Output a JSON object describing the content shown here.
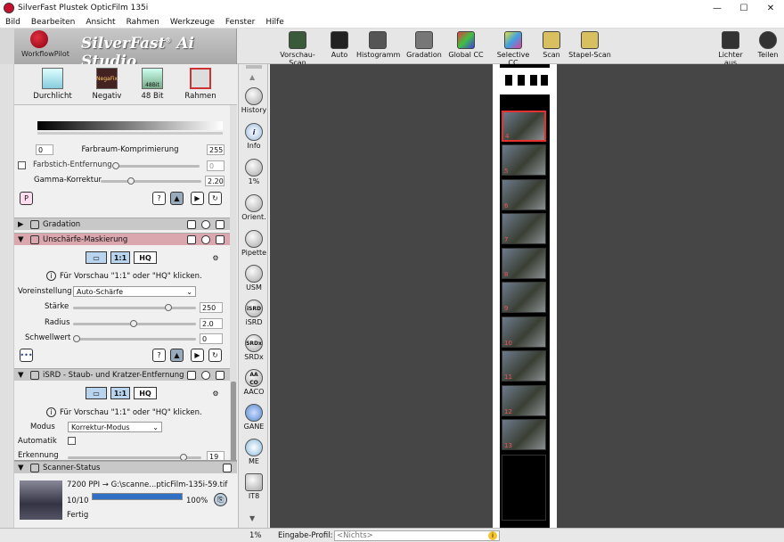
{
  "window": {
    "title": "SilverFast  Plustek OpticFilm 135i",
    "min": "—",
    "max": "☐",
    "close": "✕"
  },
  "menu": [
    "Bild",
    "Bearbeiten",
    "Ansicht",
    "Rahmen",
    "Werkzeuge",
    "Fenster",
    "Hilfe"
  ],
  "logo": {
    "workflow": "WorkflowPilot",
    "brand": "SilverFast",
    "ai": "Ai Studio"
  },
  "tools": [
    {
      "label": "Vorschau-Scan",
      "color": "#3a5a3a"
    },
    {
      "label": "Auto",
      "color": "#222"
    },
    {
      "label": "Histogramm",
      "color": "#555"
    },
    {
      "label": "Gradation",
      "color": "#777"
    },
    {
      "label": "Global CC",
      "color": "#e04040"
    },
    {
      "label": "Selective CC",
      "color": "#40a0e0"
    },
    {
      "label": "Scan",
      "color": "#d8c060"
    },
    {
      "label": "Stapel-Scan",
      "color": "#d8c060"
    },
    {
      "label": "Lichter aus",
      "color": "#333"
    },
    {
      "label": "Teilen",
      "color": "#333"
    }
  ],
  "modes": [
    {
      "label": "Durchlicht"
    },
    {
      "label": "Negativ",
      "badge": "NegaFix"
    },
    {
      "label": "48 Bit",
      "badge": "48Bit"
    },
    {
      "label": "Rahmen"
    }
  ],
  "farbraum": {
    "min": "0",
    "label": "Farbraum-Komprimierung",
    "max": "255"
  },
  "farbstich": {
    "label": "Farbstich-Entfernung",
    "value": "0"
  },
  "gamma": {
    "label": "Gamma-Korrektur",
    "value": "2.20"
  },
  "sections": {
    "gradation": "Gradation",
    "usm": "Unschärfe-Maskierung",
    "isrd": "iSRD - Staub- und Kratzer-Entfernung",
    "scanner": "Scanner-Status"
  },
  "usm": {
    "hint": "Für Vorschau \"1:1\" oder \"HQ\" klicken.",
    "preset_label": "Voreinstellung",
    "preset": "Auto-Schärfe",
    "staerke_label": "Stärke",
    "staerke": "250",
    "radius_label": "Radius",
    "radius": "2.0",
    "schwelle_label": "Schwellwert",
    "schwelle": "0",
    "btn11": "1:1",
    "btnhq": "HQ"
  },
  "isrd": {
    "hint": "Für Vorschau \"1:1\" oder \"HQ\" klicken.",
    "modus_label": "Modus",
    "modus": "Korrektur-Modus",
    "auto_label": "Automatik",
    "erkennung_label": "Erkennung",
    "erkennung": "19",
    "btn11": "1:1",
    "btnhq": "HQ"
  },
  "scanstatus": {
    "line1": "7200 PPI → G:\\scanne...pticFilm-135i-59.tif",
    "count": "10/10",
    "percent": "100%",
    "state": "Fertig",
    "progress": 1.0
  },
  "vtools": [
    "History",
    "Info",
    "1%",
    "Orient.",
    "Pipette",
    "USM",
    "iSRD",
    "SRDx",
    "AACO",
    "GANE",
    "ME",
    "IT8"
  ],
  "vtool_badges": {
    "iSRD": "iSRD",
    "SRDx": "SRDx",
    "AACO": "AA CO"
  },
  "statusbar": {
    "zoom": "1%",
    "profile_label": "Eingabe-Profil:",
    "profile": "<Nichts>"
  },
  "frames": [
    "4",
    "5",
    "6",
    "7",
    "8",
    "9",
    "10",
    "11",
    "12",
    "13"
  ]
}
